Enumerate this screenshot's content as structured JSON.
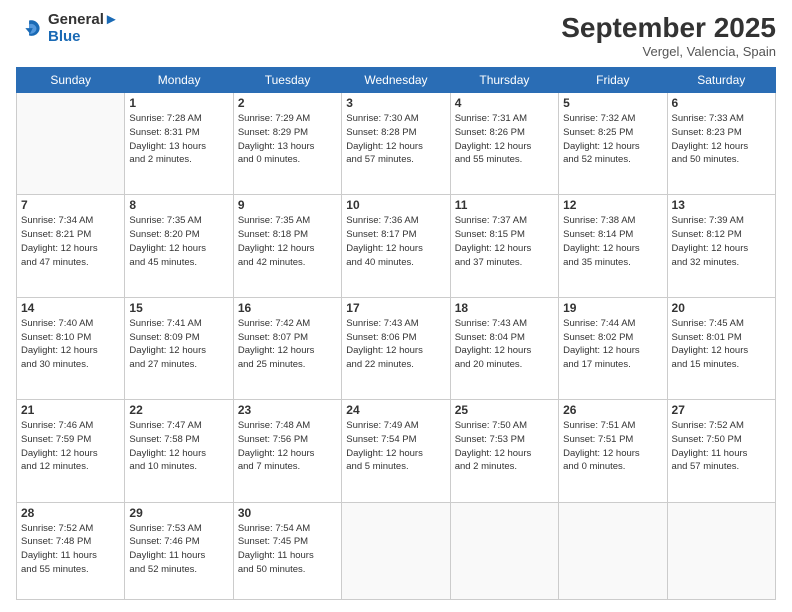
{
  "header": {
    "logo_line1": "General",
    "logo_line2": "Blue",
    "month": "September 2025",
    "location": "Vergel, Valencia, Spain"
  },
  "weekdays": [
    "Sunday",
    "Monday",
    "Tuesday",
    "Wednesday",
    "Thursday",
    "Friday",
    "Saturday"
  ],
  "weeks": [
    [
      {
        "day": "",
        "info": ""
      },
      {
        "day": "1",
        "info": "Sunrise: 7:28 AM\nSunset: 8:31 PM\nDaylight: 13 hours\nand 2 minutes."
      },
      {
        "day": "2",
        "info": "Sunrise: 7:29 AM\nSunset: 8:29 PM\nDaylight: 13 hours\nand 0 minutes."
      },
      {
        "day": "3",
        "info": "Sunrise: 7:30 AM\nSunset: 8:28 PM\nDaylight: 12 hours\nand 57 minutes."
      },
      {
        "day": "4",
        "info": "Sunrise: 7:31 AM\nSunset: 8:26 PM\nDaylight: 12 hours\nand 55 minutes."
      },
      {
        "day": "5",
        "info": "Sunrise: 7:32 AM\nSunset: 8:25 PM\nDaylight: 12 hours\nand 52 minutes."
      },
      {
        "day": "6",
        "info": "Sunrise: 7:33 AM\nSunset: 8:23 PM\nDaylight: 12 hours\nand 50 minutes."
      }
    ],
    [
      {
        "day": "7",
        "info": "Sunrise: 7:34 AM\nSunset: 8:21 PM\nDaylight: 12 hours\nand 47 minutes."
      },
      {
        "day": "8",
        "info": "Sunrise: 7:35 AM\nSunset: 8:20 PM\nDaylight: 12 hours\nand 45 minutes."
      },
      {
        "day": "9",
        "info": "Sunrise: 7:35 AM\nSunset: 8:18 PM\nDaylight: 12 hours\nand 42 minutes."
      },
      {
        "day": "10",
        "info": "Sunrise: 7:36 AM\nSunset: 8:17 PM\nDaylight: 12 hours\nand 40 minutes."
      },
      {
        "day": "11",
        "info": "Sunrise: 7:37 AM\nSunset: 8:15 PM\nDaylight: 12 hours\nand 37 minutes."
      },
      {
        "day": "12",
        "info": "Sunrise: 7:38 AM\nSunset: 8:14 PM\nDaylight: 12 hours\nand 35 minutes."
      },
      {
        "day": "13",
        "info": "Sunrise: 7:39 AM\nSunset: 8:12 PM\nDaylight: 12 hours\nand 32 minutes."
      }
    ],
    [
      {
        "day": "14",
        "info": "Sunrise: 7:40 AM\nSunset: 8:10 PM\nDaylight: 12 hours\nand 30 minutes."
      },
      {
        "day": "15",
        "info": "Sunrise: 7:41 AM\nSunset: 8:09 PM\nDaylight: 12 hours\nand 27 minutes."
      },
      {
        "day": "16",
        "info": "Sunrise: 7:42 AM\nSunset: 8:07 PM\nDaylight: 12 hours\nand 25 minutes."
      },
      {
        "day": "17",
        "info": "Sunrise: 7:43 AM\nSunset: 8:06 PM\nDaylight: 12 hours\nand 22 minutes."
      },
      {
        "day": "18",
        "info": "Sunrise: 7:43 AM\nSunset: 8:04 PM\nDaylight: 12 hours\nand 20 minutes."
      },
      {
        "day": "19",
        "info": "Sunrise: 7:44 AM\nSunset: 8:02 PM\nDaylight: 12 hours\nand 17 minutes."
      },
      {
        "day": "20",
        "info": "Sunrise: 7:45 AM\nSunset: 8:01 PM\nDaylight: 12 hours\nand 15 minutes."
      }
    ],
    [
      {
        "day": "21",
        "info": "Sunrise: 7:46 AM\nSunset: 7:59 PM\nDaylight: 12 hours\nand 12 minutes."
      },
      {
        "day": "22",
        "info": "Sunrise: 7:47 AM\nSunset: 7:58 PM\nDaylight: 12 hours\nand 10 minutes."
      },
      {
        "day": "23",
        "info": "Sunrise: 7:48 AM\nSunset: 7:56 PM\nDaylight: 12 hours\nand 7 minutes."
      },
      {
        "day": "24",
        "info": "Sunrise: 7:49 AM\nSunset: 7:54 PM\nDaylight: 12 hours\nand 5 minutes."
      },
      {
        "day": "25",
        "info": "Sunrise: 7:50 AM\nSunset: 7:53 PM\nDaylight: 12 hours\nand 2 minutes."
      },
      {
        "day": "26",
        "info": "Sunrise: 7:51 AM\nSunset: 7:51 PM\nDaylight: 12 hours\nand 0 minutes."
      },
      {
        "day": "27",
        "info": "Sunrise: 7:52 AM\nSunset: 7:50 PM\nDaylight: 11 hours\nand 57 minutes."
      }
    ],
    [
      {
        "day": "28",
        "info": "Sunrise: 7:52 AM\nSunset: 7:48 PM\nDaylight: 11 hours\nand 55 minutes."
      },
      {
        "day": "29",
        "info": "Sunrise: 7:53 AM\nSunset: 7:46 PM\nDaylight: 11 hours\nand 52 minutes."
      },
      {
        "day": "30",
        "info": "Sunrise: 7:54 AM\nSunset: 7:45 PM\nDaylight: 11 hours\nand 50 minutes."
      },
      {
        "day": "",
        "info": ""
      },
      {
        "day": "",
        "info": ""
      },
      {
        "day": "",
        "info": ""
      },
      {
        "day": "",
        "info": ""
      }
    ]
  ]
}
